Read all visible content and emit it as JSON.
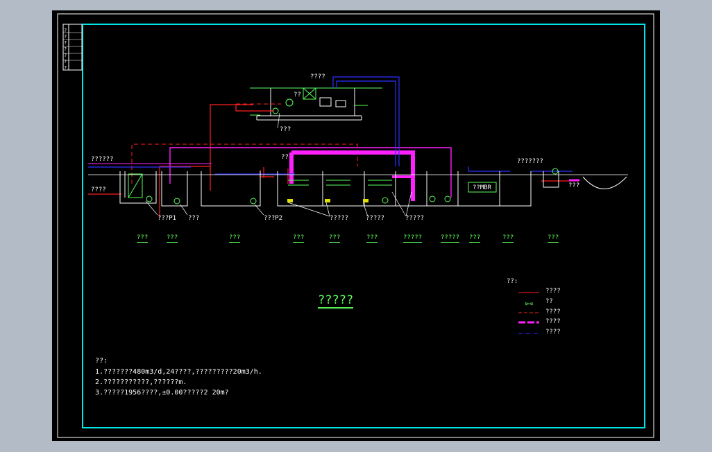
{
  "drawing_title": "?????",
  "labels": {
    "roof_title": "????",
    "roof_sub": "??",
    "roof_equipment": "???",
    "left_input": "??????",
    "left_arrow": "????",
    "right_tag": "???????",
    "right_small": "???",
    "pump_p1": "???P1",
    "pump_label_2": "???",
    "pump_p2": "???P2",
    "callout_1": "?????",
    "callout_2": "?????",
    "callout_3": "?????",
    "tank_small": "??",
    "mbr_label": "??MBR"
  },
  "unit_names": [
    "???",
    "???",
    "???",
    "???",
    "???",
    "???",
    "?????",
    "?????",
    "???",
    "???",
    "???"
  ],
  "legend": {
    "title": "??:",
    "items": [
      {
        "label": "????",
        "color": "#ff2020",
        "style": "solid"
      },
      {
        "label": "??",
        "color": "#5bff5b",
        "style": "symbol"
      },
      {
        "label": "????",
        "color": "#ff2020",
        "style": "dashed"
      },
      {
        "label": "????",
        "color": "#ff20ff",
        "style": "thick-dashed"
      },
      {
        "label": "????",
        "color": "#3030ff",
        "style": "dash-dot"
      }
    ]
  },
  "notes": {
    "title": "??:",
    "lines": [
      "1.???????480m3/d,24????,?????????20m3/h.",
      "2.???????????,??????m.",
      "3.?????1956????,±0.00?????2 20m?"
    ]
  },
  "title_block_chars": [
    "?",
    "?",
    "?",
    "?",
    "?",
    "?",
    "?"
  ],
  "colors": {
    "frame_border": "#ffffff",
    "inner_border": "#00e5e5",
    "pipe_sludge": "#ff2020",
    "pipe_air": "#ff20ff",
    "pipe_water": "#3030ff",
    "structure": "#ffffff",
    "equipment": "#5bff5b"
  }
}
